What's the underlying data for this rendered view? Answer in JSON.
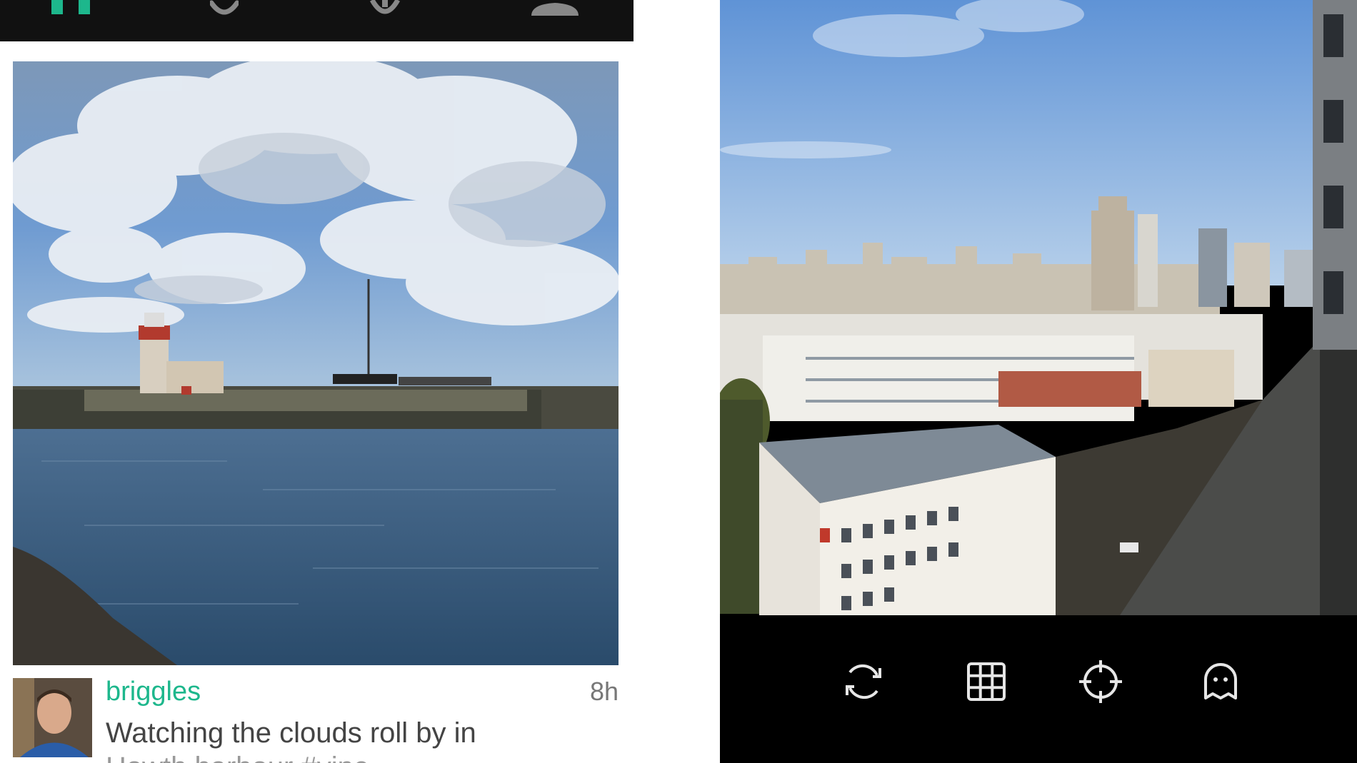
{
  "app": {
    "accent": "#1db78c",
    "nav_background": "#111111"
  },
  "top_nav": {
    "items": [
      {
        "icon": "home-feed-icon",
        "active": true
      },
      {
        "icon": "popular-icon",
        "active": false
      },
      {
        "icon": "explore-icon",
        "active": false
      },
      {
        "icon": "profile-icon",
        "active": false
      }
    ]
  },
  "post": {
    "photo": "lighthouse-harbour-photo",
    "username": "briggles",
    "time": "8h",
    "caption_line1": "Watching the clouds roll by in",
    "caption_line2": "Howth harbour #vine"
  },
  "camera": {
    "viewfinder": "city-skyline-view",
    "toolbar": [
      {
        "icon": "switch-camera-icon"
      },
      {
        "icon": "grid-icon"
      },
      {
        "icon": "focus-icon"
      },
      {
        "icon": "ghost-icon"
      }
    ]
  }
}
